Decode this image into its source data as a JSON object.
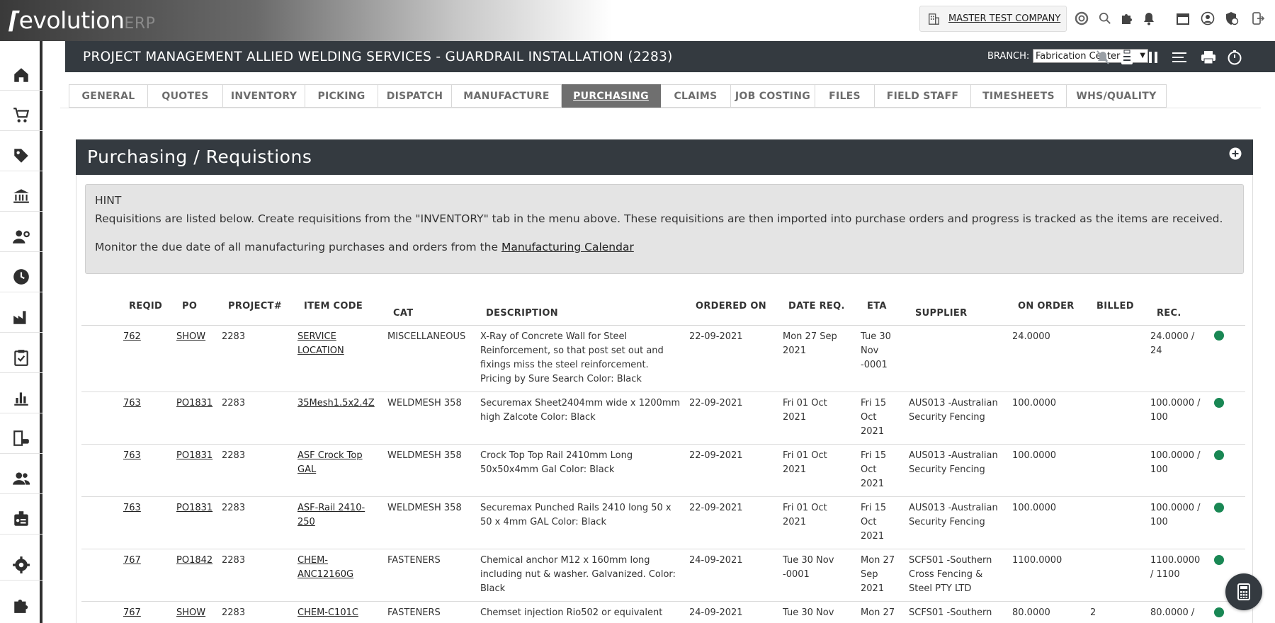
{
  "app": {
    "logo_main": "evolution",
    "logo_suffix": "ERP"
  },
  "company": {
    "name": "MASTER TEST COMPANY"
  },
  "project": {
    "title": "PROJECT MANAGEMENT ALLIED WELDING SERVICES - GUARDRAIL INSTALLATION (2283)",
    "branch_label": "BRANCH:",
    "branch_value": "Fabrication Center"
  },
  "tabs": [
    {
      "label": "GENERAL"
    },
    {
      "label": "QUOTES"
    },
    {
      "label": "INVENTORY"
    },
    {
      "label": "PICKING"
    },
    {
      "label": "DISPATCH"
    },
    {
      "label": "MANUFACTURE"
    },
    {
      "label": "PURCHASING",
      "active": true
    },
    {
      "label": "CLAIMS"
    },
    {
      "label": "JOB COSTING"
    },
    {
      "label": "FILES"
    },
    {
      "label": "FIELD STAFF"
    },
    {
      "label": "TIMESHEETS"
    },
    {
      "label": "WHS/QUALITY"
    }
  ],
  "panel": {
    "title": "Purchasing / Requistions"
  },
  "hint": {
    "title": "HINT",
    "text": "Requisitions are listed below. Create requisitions from the \"INVENTORY\" tab in the menu above. These requisitions are then imported into purchase orders and progress is tracked as the items are received.",
    "text2": "Monitor the due date of all manufacturing purchases and orders from the ",
    "link": "Manufacturing Calendar"
  },
  "table": {
    "headers": {
      "reqid": "REQID",
      "po": "PO",
      "project": "PROJECT#",
      "item_code": "ITEM CODE",
      "cat": "CAT",
      "description": "DESCRIPTION",
      "ordered_on": "ORDERED ON",
      "date_req": "DATE REQ.",
      "eta": "ETA",
      "supplier": "SUPPLIER",
      "on_order": "ON ORDER",
      "billed": "BILLED",
      "rec": "REC."
    },
    "rows": [
      {
        "reqid": "762",
        "po": "SHOW",
        "project": "2283",
        "item_code_1": "SERVICE",
        "item_code_2": "LOCATION",
        "cat": "MISCELLANEOUS",
        "desc_1": "X-Ray of Concrete Wall for Steel",
        "desc_2": "Reinforcement, so that post set out and",
        "desc_3": "fixings miss the steel reinforcement.",
        "desc_4": "Pricing by Sure Search Color: Black",
        "ordered_on": "22-09-2021",
        "date_req_1": "Mon 27 Sep",
        "date_req_2": "2021",
        "eta_1": "Tue 30",
        "eta_2": "Nov",
        "eta_3": "-0001",
        "supplier_1": "",
        "supplier_2": "",
        "supplier_3": "",
        "on_order": "24.0000",
        "billed": "",
        "rec_1": "24.0000 /",
        "rec_2": "24"
      },
      {
        "reqid": "763",
        "po": "PO1831",
        "project": "2283",
        "item_code_1": "35Mesh1.5x2.4Z",
        "item_code_2": "",
        "cat": "WELDMESH 358",
        "desc_1": "Securemax Sheet2404mm wide x 1200mm",
        "desc_2": "high Zalcote Color: Black",
        "desc_3": "",
        "desc_4": "",
        "ordered_on": "22-09-2021",
        "date_req_1": "Fri 01 Oct",
        "date_req_2": "2021",
        "eta_1": "Fri 15",
        "eta_2": "Oct",
        "eta_3": "2021",
        "supplier_1": "AUS013 -Australian",
        "supplier_2": "Security Fencing",
        "supplier_3": "",
        "on_order": "100.0000",
        "billed": "",
        "rec_1": "100.0000 /",
        "rec_2": "100"
      },
      {
        "reqid": "763",
        "po": "PO1831",
        "project": "2283",
        "item_code_1": "ASF Crock Top",
        "item_code_2": "GAL",
        "cat": "WELDMESH 358",
        "desc_1": "Crock Top Top Rail 2410mm Long",
        "desc_2": "50x50x4mm Gal Color: Black",
        "desc_3": "",
        "desc_4": "",
        "ordered_on": "22-09-2021",
        "date_req_1": "Fri 01 Oct",
        "date_req_2": "2021",
        "eta_1": "Fri 15",
        "eta_2": "Oct",
        "eta_3": "2021",
        "supplier_1": "AUS013 -Australian",
        "supplier_2": "Security Fencing",
        "supplier_3": "",
        "on_order": "100.0000",
        "billed": "",
        "rec_1": "100.0000 /",
        "rec_2": "100"
      },
      {
        "reqid": "763",
        "po": "PO1831",
        "project": "2283",
        "item_code_1": "ASF-Rail 2410-",
        "item_code_2": "250",
        "cat": "WELDMESH 358",
        "desc_1": "Securemax Punched Rails 2410 long 50 x",
        "desc_2": "50 x 4mm GAL Color: Black",
        "desc_3": "",
        "desc_4": "",
        "ordered_on": "22-09-2021",
        "date_req_1": "Fri 01 Oct",
        "date_req_2": "2021",
        "eta_1": "Fri 15",
        "eta_2": "Oct",
        "eta_3": "2021",
        "supplier_1": "AUS013 -Australian",
        "supplier_2": "Security Fencing",
        "supplier_3": "",
        "on_order": "100.0000",
        "billed": "",
        "rec_1": "100.0000 /",
        "rec_2": "100"
      },
      {
        "reqid": "767",
        "po": "PO1842",
        "project": "2283",
        "item_code_1": "CHEM-",
        "item_code_2": "ANC12160G",
        "cat": "FASTENERS",
        "desc_1": "Chemical anchor M12 x 160mm long",
        "desc_2": "including nut & washer. Galvanized. Color:",
        "desc_3": "Black",
        "desc_4": "",
        "ordered_on": "24-09-2021",
        "date_req_1": "Tue 30 Nov",
        "date_req_2": "-0001",
        "eta_1": "Mon 27",
        "eta_2": "Sep",
        "eta_3": "2021",
        "supplier_1": "SCFS01 -Southern",
        "supplier_2": "Cross Fencing &",
        "supplier_3": "Steel PTY LTD",
        "on_order": "1100.0000",
        "billed": "",
        "rec_1": "1100.0000",
        "rec_2": "/ 1100"
      },
      {
        "reqid": "767",
        "po": "SHOW",
        "project": "2283",
        "item_code_1": "CHEM-C101C",
        "item_code_2": "",
        "cat": "FASTENERS",
        "desc_1": "Chemset injection Rio502 or equivalent",
        "desc_2": "",
        "desc_3": "",
        "desc_4": "",
        "ordered_on": "24-09-2021",
        "date_req_1": "Tue 30 Nov",
        "date_req_2": "",
        "eta_1": "Mon 27",
        "eta_2": "",
        "eta_3": "",
        "supplier_1": "SCFS01 -Southern",
        "supplier_2": "",
        "supplier_3": "",
        "on_order": "80.0000",
        "billed": "2",
        "rec_1": "80.0000 /",
        "rec_2": ""
      }
    ]
  },
  "colors": {
    "dark": "#343a40",
    "status_green": "#198754",
    "tab_active": "#6f6f6f"
  },
  "icons": [
    "home-icon",
    "cart-icon",
    "tag-icon",
    "bank-icon",
    "user-cog-icon",
    "clock-icon",
    "factory-icon",
    "clipboard-check-icon",
    "chart-icon",
    "building-car-icon",
    "users-icon",
    "id-badge-icon",
    "gear-icon",
    "puzzle-icon"
  ]
}
